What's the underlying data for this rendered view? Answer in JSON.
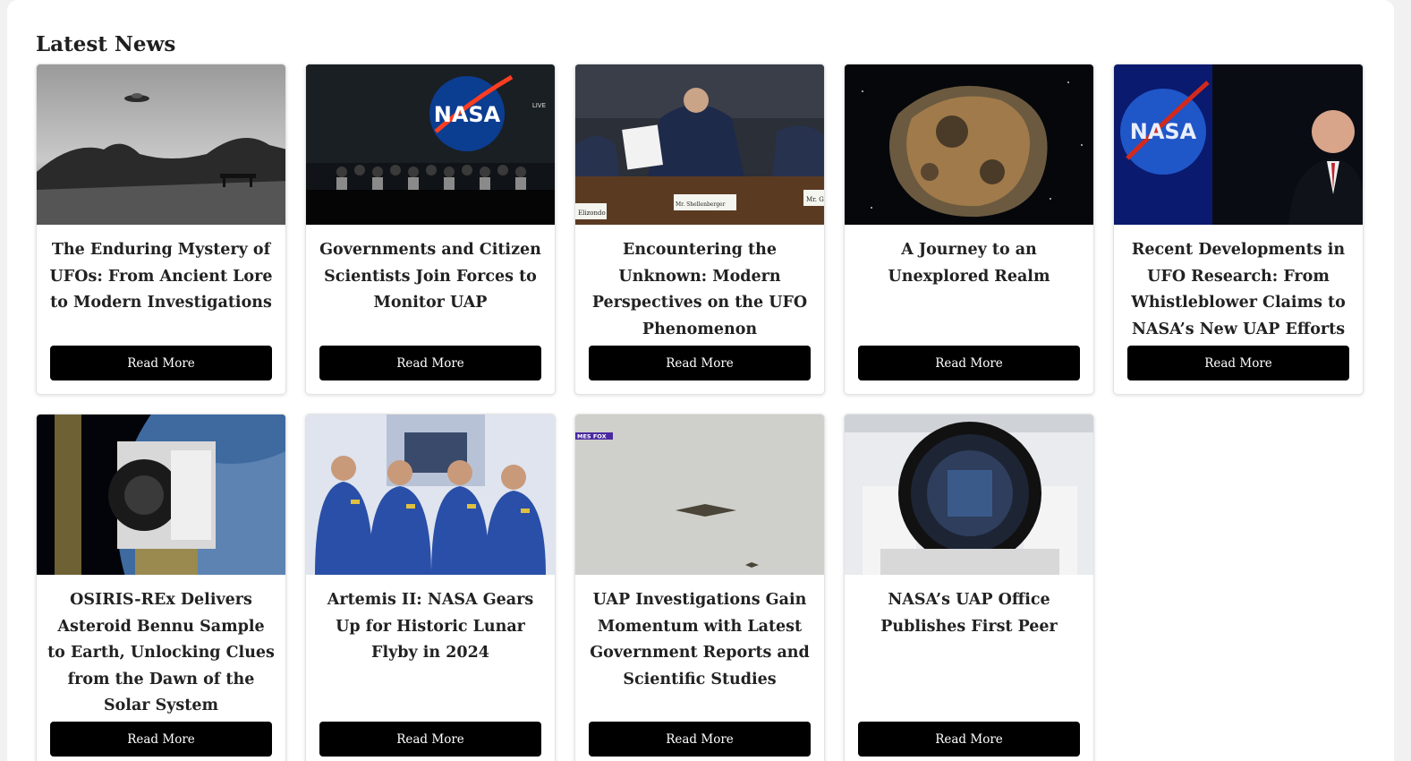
{
  "section": {
    "title": "Latest News"
  },
  "articles": [
    {
      "title": "The Enduring Mystery of UFOs: From Ancient Lore to Modern Investigations",
      "button": "Read More",
      "image": "ufo-over-field-photo"
    },
    {
      "title": "Governments and Citizen Scientists Join Forces to Monitor UAP",
      "button": "Read More",
      "image": "nasa-press-conference-photo",
      "logo_text": "NASA",
      "live_text": "LIVE"
    },
    {
      "title": "Encountering the Unknown: Modern Perspectives on the UFO Phenomenon",
      "button": "Read More",
      "image": "congressional-hearing-photo",
      "nameplate_1": "Elizondo",
      "nameplate_2": "Mr. Shellenberger",
      "nameplate_3": "Mr. G"
    },
    {
      "title": "A Journey to an Unexplored Realm",
      "button": "Read More",
      "image": "asteroid-psyche-illustration"
    },
    {
      "title": "Recent Developments in UFO Research: From Whistleblower Claims to NASA’s New UAP Efforts",
      "button": "Read More",
      "image": "nasa-administrator-photo",
      "logo_text": "NASA"
    },
    {
      "title": "OSIRIS-REx Delivers Asteroid Bennu Sample to Earth, Unlocking Clues from the Dawn of the Solar System",
      "button": "Read More",
      "image": "osiris-rex-spacecraft-image"
    },
    {
      "title": "Artemis II: NASA Gears Up for Historic Lunar Flyby in 2024",
      "button": "Read More",
      "image": "artemis-crew-photo"
    },
    {
      "title": "UAP Investigations Gain Momentum with Latest Government Reports and Scientific Studies",
      "button": "Read More",
      "image": "uap-sky-footage-still",
      "overlay_text": "MES FOX"
    },
    {
      "title": "NASA’s UAP Office Publishes First Peer",
      "button": "Read More",
      "image": "telescope-camera-lab-photo"
    }
  ],
  "colors": {
    "button_bg": "#000000",
    "button_text": "#ffffff",
    "title_text": "#222222",
    "page_bg": "#f1f1f1"
  }
}
